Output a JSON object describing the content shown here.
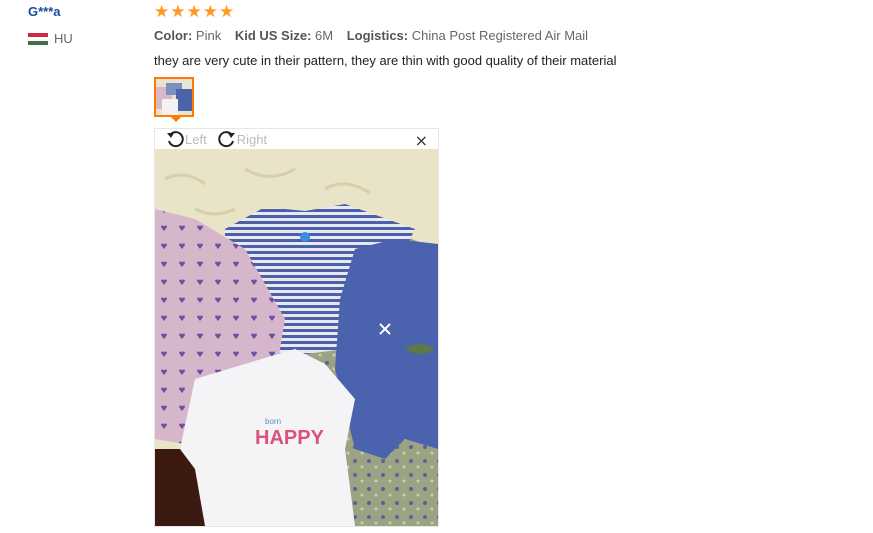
{
  "user": {
    "name": "G***a",
    "country_code": "HU",
    "flag_colors": [
      "#cd2a3e",
      "#ffffff",
      "#436f4d"
    ]
  },
  "review": {
    "rating": 5,
    "star_glyph": "★",
    "attributes": [
      {
        "label": "Color:",
        "value": "Pink"
      },
      {
        "label": "Kid US Size:",
        "value": "6M"
      },
      {
        "label": "Logistics:",
        "value": "China Post Registered Air Mail"
      }
    ],
    "text": "they are very cute in their pattern, they are thin with good quality of their material"
  },
  "viewer": {
    "rotate_left_label": "Left",
    "rotate_right_label": "Right",
    "close_glyph": "×",
    "photo_text": "HAPPY",
    "photo_small_text": "born"
  },
  "colors": {
    "accent_orange": "#ff7a00",
    "star": "#ff9a1e",
    "user_link": "#1a4a9c"
  }
}
